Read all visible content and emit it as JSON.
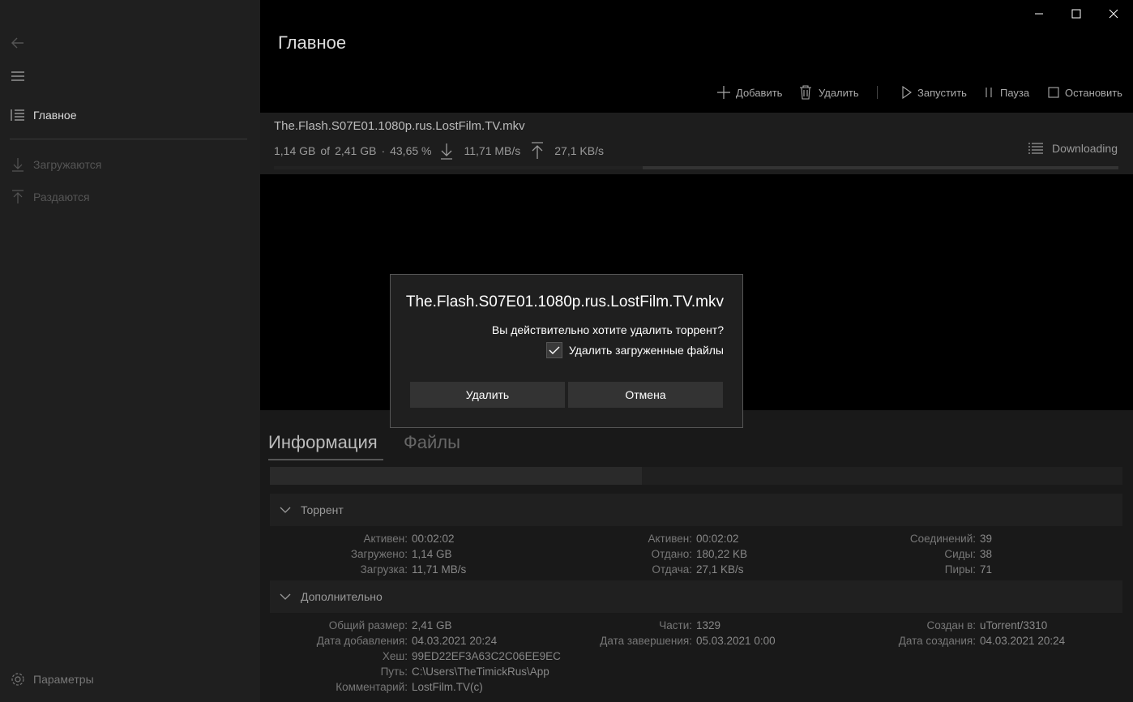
{
  "sidebar": {
    "back_icon": "back-arrow-icon",
    "menu_icon": "hamburger-icon",
    "items": [
      {
        "label": "Главное",
        "icon": "list-icon"
      },
      {
        "label": "Загружаются",
        "icon": "download-arrow-icon"
      },
      {
        "label": "Раздаются",
        "icon": "upload-arrow-icon"
      }
    ],
    "settings_label": "Параметры"
  },
  "header": {
    "title": "Главное"
  },
  "toolbar": {
    "add_label": "Добавить",
    "delete_label": "Удалить",
    "start_label": "Запустить",
    "pause_label": "Пауза",
    "stop_label": "Остановить"
  },
  "torrent": {
    "name": "The.Flash.S07E01.1080p.rus.LostFilm.TV.mkv",
    "downloaded": "1,14 GB",
    "of": "of",
    "total": "2,41 GB",
    "sep": "·",
    "percent": "43,65 %",
    "down_speed": "11,71 MB/s",
    "up_speed": "27,1 KB/s",
    "status": "Downloading",
    "progress": 0.4365
  },
  "tabs": {
    "info": "Информация",
    "files": "Файлы"
  },
  "sections": {
    "torrent": {
      "title": "Торрент",
      "col1": [
        {
          "k": "Активен:",
          "v": "00:02:02"
        },
        {
          "k": "Загружено:",
          "v": "1,14 GB"
        },
        {
          "k": "Загрузка:",
          "v": "11,71 MB/s"
        }
      ],
      "col2": [
        {
          "k": "Активен:",
          "v": "00:02:02"
        },
        {
          "k": "Отдано:",
          "v": "180,22 KB"
        },
        {
          "k": "Отдача:",
          "v": "27,1 KB/s"
        }
      ],
      "col3": [
        {
          "k": "Соединений:",
          "v": "39"
        },
        {
          "k": "Сиды:",
          "v": "38"
        },
        {
          "k": "Пиры:",
          "v": "71"
        }
      ]
    },
    "extra": {
      "title": "Дополнительно",
      "col1": [
        {
          "k": "Общий размер:",
          "v": "2,41 GB"
        },
        {
          "k": "Дата добавления:",
          "v": "04.03.2021 20:24"
        },
        {
          "k": "Хеш:",
          "v": "99ED22EF3A63C2C06EE9EC"
        },
        {
          "k": "Путь:",
          "v": "C:\\Users\\TheTimickRus\\App"
        },
        {
          "k": "Комментарий:",
          "v": "LostFilm.TV(c)"
        }
      ],
      "col2": [
        {
          "k": "Части:",
          "v": "1329"
        },
        {
          "k": "Дата завершения:",
          "v": "05.03.2021 0:00"
        }
      ],
      "col3": [
        {
          "k": "Создан в:",
          "v": "uTorrent/3310"
        },
        {
          "k": "Дата создания:",
          "v": "04.03.2021 20:24"
        }
      ]
    }
  },
  "dialog": {
    "title": "The.Flash.S07E01.1080p.rus.LostFilm.TV.mkv",
    "message": "Вы действительно хотите удалить торрент?",
    "checkbox_label": "Удалить загруженные файлы",
    "checkbox_checked": true,
    "confirm_label": "Удалить",
    "cancel_label": "Отмена"
  }
}
